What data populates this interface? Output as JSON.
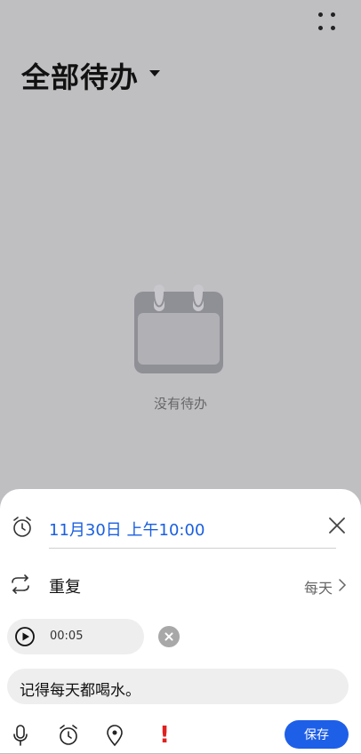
{
  "header": {
    "title": "全部待办",
    "more_icon": "more-dots-icon"
  },
  "empty_state": {
    "icon": "calendar-icon",
    "text": "没有待办"
  },
  "sheet": {
    "reminder_time": "11月30日 上午10:00",
    "repeat": {
      "label": "重复",
      "value": "每天"
    },
    "audio": {
      "duration": "00:05"
    },
    "note": {
      "value": "记得每天都喝水。"
    },
    "toolbar": {
      "urgent_mark": "!",
      "save_label": "保存"
    }
  },
  "colors": {
    "background": "#bfbfc2",
    "accent": "#1e5fe8",
    "time_text": "#1a5fe0",
    "urgent": "#e02020"
  }
}
